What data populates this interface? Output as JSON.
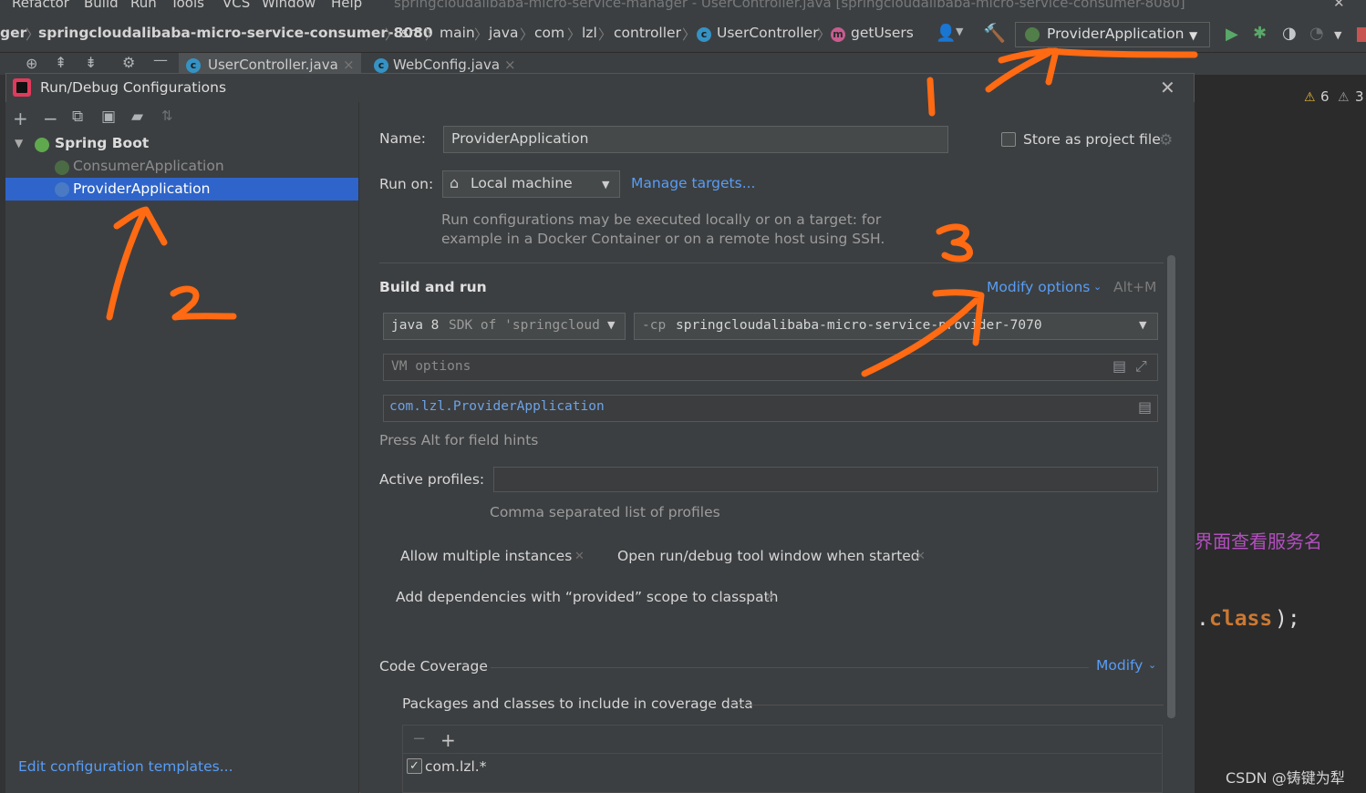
{
  "menu": [
    "Refactor",
    "Build",
    "Run",
    "Tools",
    "VCS",
    "Window",
    "Help"
  ],
  "window_title": "springcloudalibaba-micro-service-manager - UserController.java [springcloudalibaba-micro-service-consumer-8080]",
  "breadcrumbs": {
    "first": "ger",
    "project": "springcloudalibaba-micro-service-consumer-8080",
    "items": [
      "src",
      "main",
      "java",
      "com",
      "lzl",
      "controller"
    ],
    "class": "UserController",
    "method": "getUsers"
  },
  "toolbar": {
    "run_config": "ProviderApplication",
    "warnings": "6",
    "weak_warnings": "3"
  },
  "tabs": [
    {
      "label": "UserController.java"
    },
    {
      "label": "WebConfig.java"
    }
  ],
  "dialog": {
    "title": "Run/Debug Configurations",
    "tree": {
      "group": "Spring Boot",
      "items": [
        "ConsumerApplication",
        "ProviderApplication"
      ]
    },
    "edit_templates": "Edit configuration templates...",
    "name_label": "Name:",
    "name_value": "ProviderApplication",
    "store_as_project_file": "Store as project file",
    "run_on_label": "Run on:",
    "run_on_value": "Local machine",
    "manage_targets": "Manage targets...",
    "run_on_hint_line1": "Run configurations may be executed locally or on a target: for",
    "run_on_hint_line2": "example in a Docker Container or on a remote host using SSH.",
    "build_and_run": "Build and run",
    "modify_options": "Modify options",
    "modify_shortcut": "Alt+M",
    "sdk_keyword": "java 8",
    "sdk_value": "SDK of 'springcloud",
    "cp_keyword": "-cp",
    "cp_value": "springcloudalibaba-micro-service-provider-7070",
    "vm_options_placeholder": "VM options",
    "main_class": "com.lzl.ProviderApplication",
    "field_hints": "Press Alt for field hints",
    "active_profiles_label": "Active profiles:",
    "active_profiles_hint": "Comma separated list of profiles",
    "chips": [
      "Allow multiple instances",
      "Open run/debug tool window when started",
      "Add dependencies with “provided” scope to classpath"
    ],
    "code_coverage": "Code Coverage",
    "modify": "Modify",
    "coverage_packages_label": "Packages and classes to include in coverage data",
    "coverage_pattern": "com.lzl.*"
  },
  "editor": {
    "comment": "界面查看服务名",
    "code_keyword": "class",
    "code_prefix": ".",
    "code_suffix": ");"
  },
  "watermark": "CSDN @铸键为犁",
  "annotations": [
    "1",
    "2",
    "3"
  ],
  "colors": {
    "selection": "#2f65ca",
    "link": "#589df6",
    "annotation": "#ff6a13"
  }
}
